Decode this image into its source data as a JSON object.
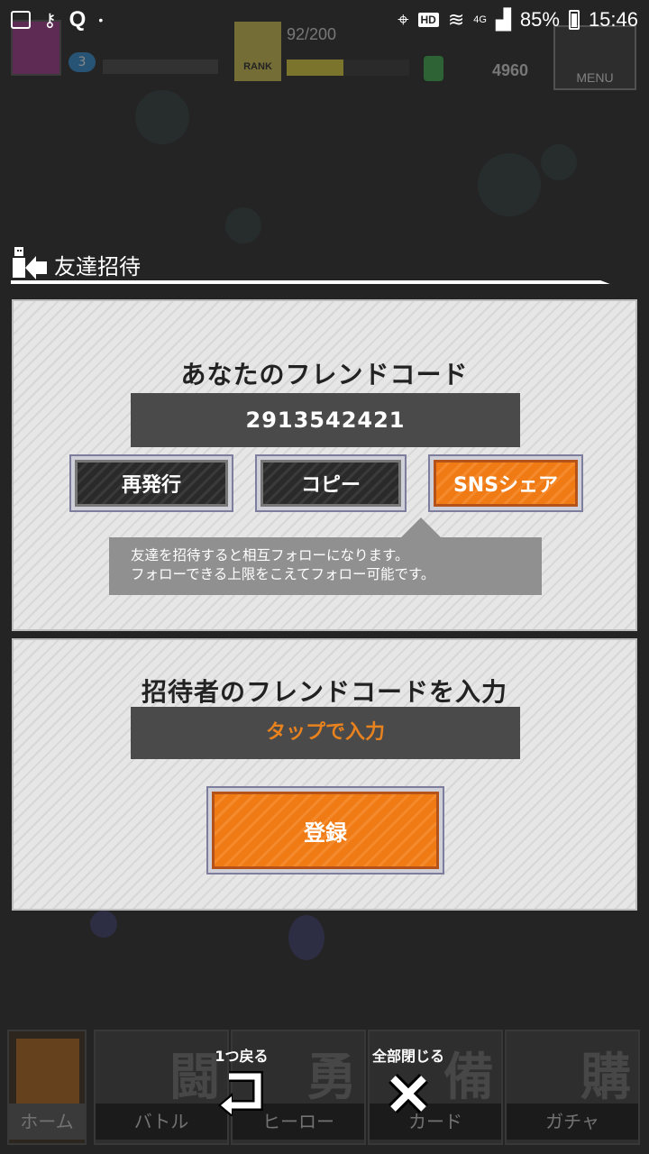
{
  "status_bar": {
    "battery": "85%",
    "time": "15:46",
    "network": "4G",
    "hd": "HD"
  },
  "game_header": {
    "level": "3",
    "rank_label": "RANK",
    "exp": "92/200",
    "coins": "4960",
    "menu_label": "MENU"
  },
  "section": {
    "title": "友達招待"
  },
  "my_code": {
    "heading": "あなたのフレンドコード",
    "code": "2913542421",
    "buttons": {
      "reissue": "再発行",
      "copy": "コピー",
      "share": "SNSシェア"
    },
    "tooltip_line1": "友達を招待すると相互フォローになります。",
    "tooltip_line2": "フォローできる上限をこえてフォロー可能です。"
  },
  "inviter": {
    "heading": "招待者のフレンドコードを入力",
    "input_placeholder": "タップで入力",
    "register_label": "登録"
  },
  "bottom_nav": {
    "home": "ホーム",
    "battle": "バトル",
    "hero": "ヒーロー",
    "card": "カード",
    "gacha": "ガチャ",
    "battle_glyph": "闘",
    "hero_glyph": "勇",
    "card_glyph": "備",
    "gacha_glyph": "購"
  },
  "actions": {
    "back_label": "1つ戻る",
    "close_all_label": "全部閉じる"
  },
  "colors": {
    "accent_orange": "#f07a14",
    "panel_bg": "#e2e2e2",
    "dark_field": "#4a4a4a"
  }
}
